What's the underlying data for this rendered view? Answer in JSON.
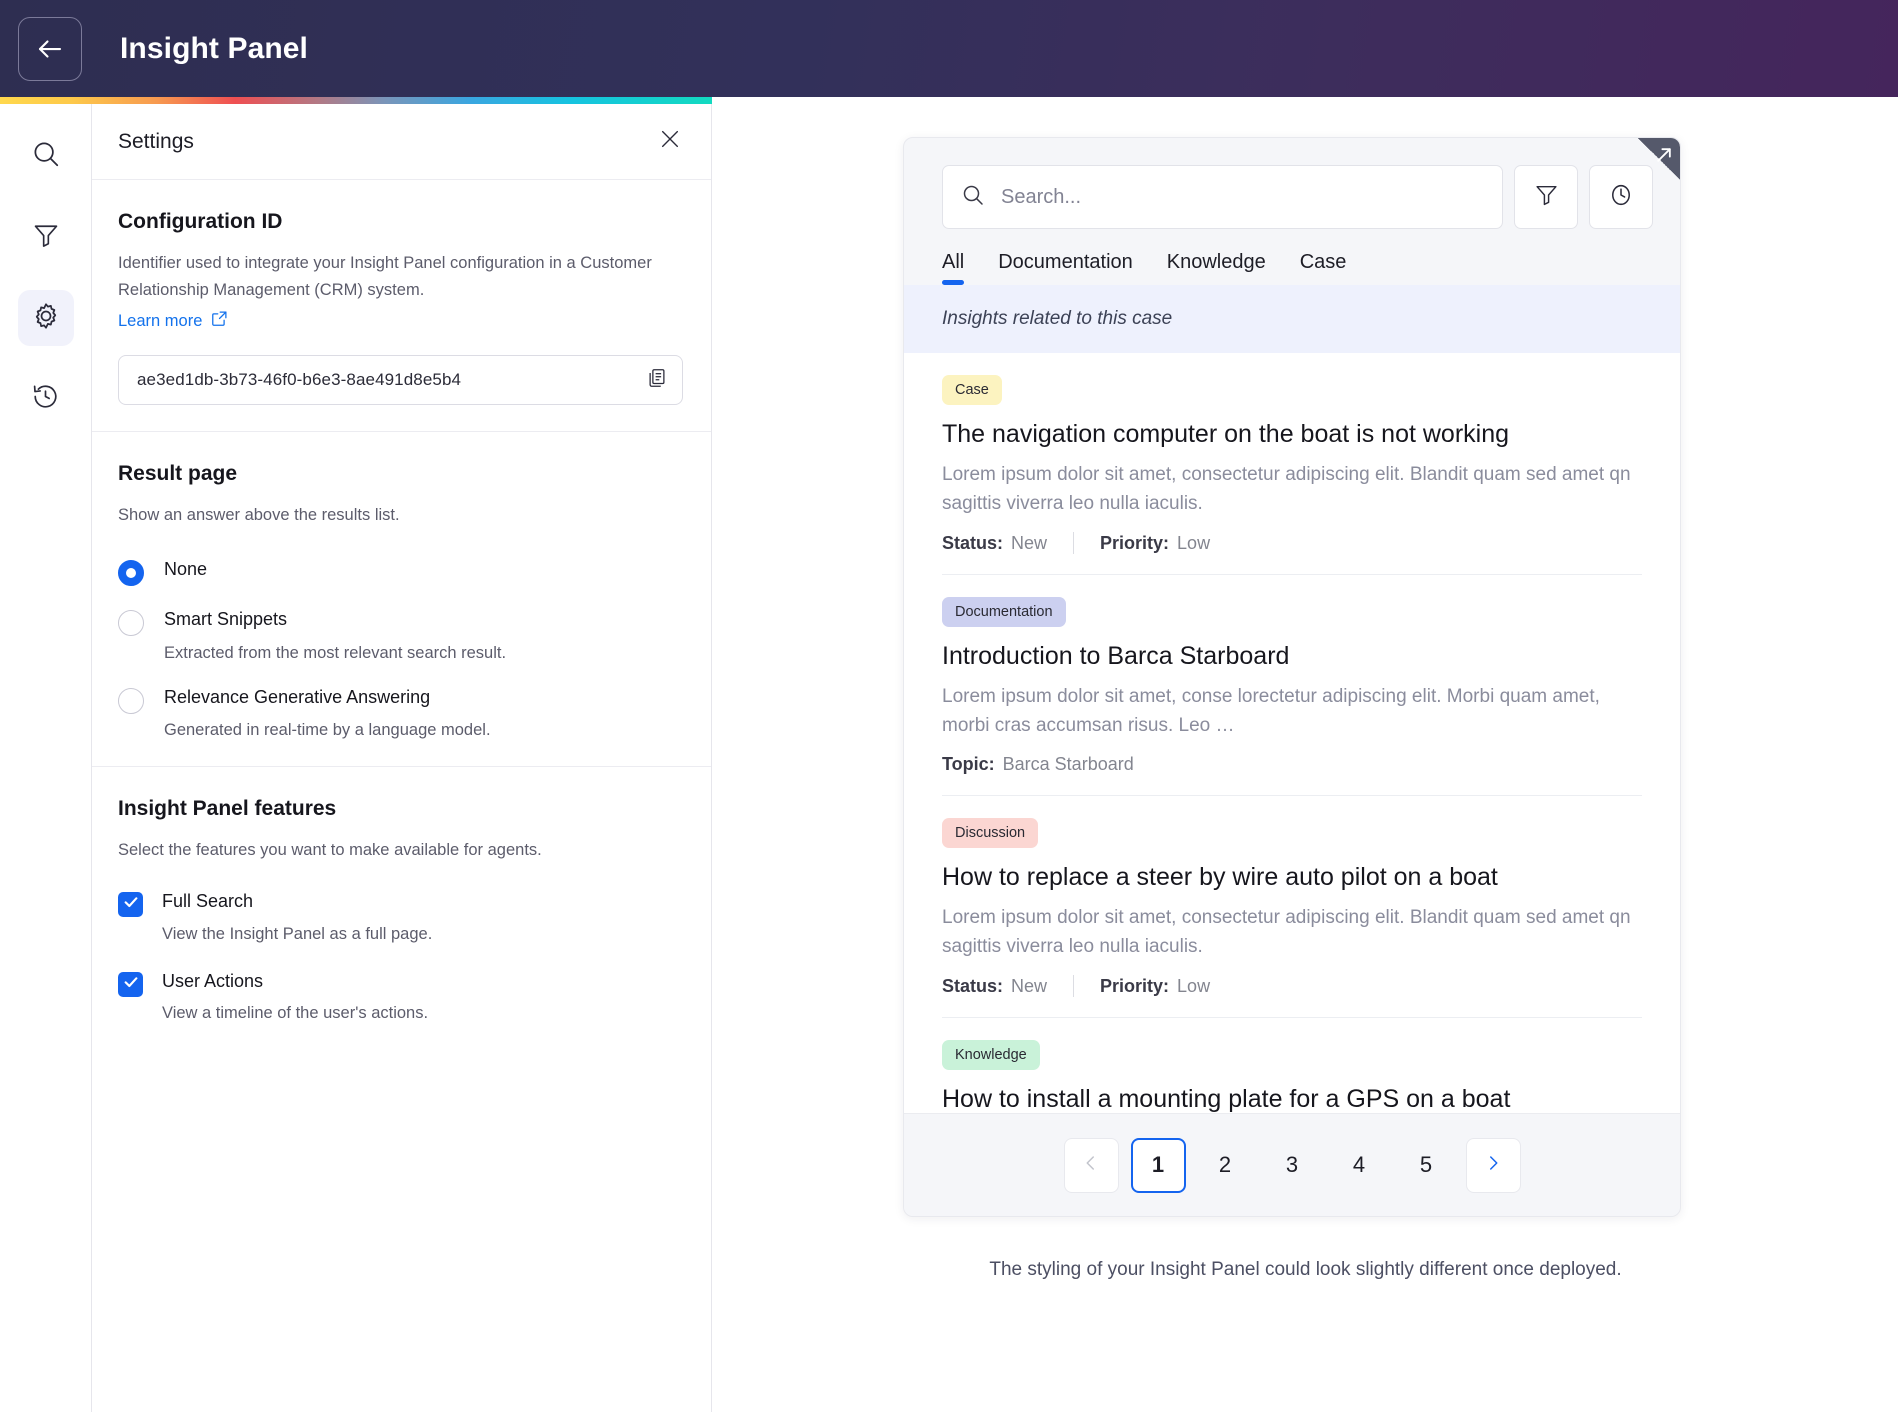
{
  "header": {
    "title": "Insight Panel",
    "back_icon": "arrow-left-icon"
  },
  "rail": {
    "items": [
      {
        "icon": "search-icon",
        "name": "rail-item-search",
        "active": false
      },
      {
        "icon": "filter-icon",
        "name": "rail-item-filter",
        "active": false
      },
      {
        "icon": "gear-icon",
        "name": "rail-item-settings",
        "active": true
      },
      {
        "icon": "history-icon",
        "name": "rail-item-history",
        "active": false
      }
    ]
  },
  "settings": {
    "panel_title": "Settings",
    "close_icon": "close-icon",
    "configuration": {
      "heading": "Configuration ID",
      "description": "Identifier used to integrate your Insight Panel configuration in a Customer Relationship Management (CRM) system.",
      "learn_more": "Learn more",
      "external_link_icon": "external-link-icon",
      "value": "ae3ed1db-3b73-46f0-b6e3-8ae491d8e5b4",
      "copy_icon": "copy-icon"
    },
    "result_page": {
      "heading": "Result page",
      "description": "Show an answer above the results list.",
      "options": [
        {
          "label": "None",
          "sub": "",
          "selected": true
        },
        {
          "label": "Smart Snippets",
          "sub": "Extracted from the most relevant search result.",
          "selected": false
        },
        {
          "label": "Relevance Generative Answering",
          "sub": "Generated in real-time by a language model.",
          "selected": false
        }
      ]
    },
    "features": {
      "heading": "Insight Panel features",
      "description": "Select the features you want to make available for agents.",
      "items": [
        {
          "label": "Full Search",
          "sub": "View the Insight Panel as a full page.",
          "checked": true
        },
        {
          "label": "User Actions",
          "sub": "View a timeline of the user's actions.",
          "checked": true
        }
      ]
    }
  },
  "preview": {
    "resize_icon": "resize-arrow-icon",
    "search": {
      "placeholder": "Search...",
      "search_icon": "search-icon",
      "filter_icon": "filter-icon",
      "history_icon": "clock-icon"
    },
    "tabs": [
      {
        "label": "All",
        "active": true
      },
      {
        "label": "Documentation",
        "active": false
      },
      {
        "label": "Knowledge",
        "active": false
      },
      {
        "label": "Case",
        "active": false
      }
    ],
    "banner": "Insights related to this case",
    "results": [
      {
        "badge": "Case",
        "badge_color": "#fcf3c0",
        "title": "The navigation computer on the boat is not working",
        "snippet": "Lorem ipsum dolor sit amet, consectetur adipiscing elit. Blandit quam sed amet qn sagittis viverra leo nulla iaculis.",
        "meta": [
          {
            "key": "Status:",
            "value": "New"
          },
          {
            "key": "Priority:",
            "value": "Low"
          }
        ]
      },
      {
        "badge": "Documentation",
        "badge_color": "#ccd0f0",
        "title": "Introduction to Barca Starboard",
        "snippet": "Lorem ipsum dolor sit amet, conse  lorectetur adipiscing elit. Morbi quam amet, morbi cras accumsan risus. Leo …",
        "meta": [
          {
            "key": "Topic:",
            "value": "Barca Starboard"
          }
        ]
      },
      {
        "badge": "Discussion",
        "badge_color": "#fbd6d2",
        "title": "How to replace a steer by wire auto pilot on a boat",
        "snippet": "Lorem ipsum dolor sit amet, consectetur adipiscing elit. Blandit quam sed amet qn sagittis viverra leo nulla iaculis.",
        "meta": [
          {
            "key": "Status:",
            "value": "New"
          },
          {
            "key": "Priority:",
            "value": "Low"
          }
        ]
      },
      {
        "badge": "Knowledge",
        "badge_color": "#c9f2d9",
        "title": "How to install a mounting plate for a GPS on a boat",
        "snippet": "",
        "meta": []
      }
    ],
    "pagination": {
      "prev_icon": "chevron-left-icon",
      "next_icon": "chevron-right-icon",
      "pages": [
        "1",
        "2",
        "3",
        "4",
        "5"
      ],
      "current": "1"
    },
    "footnote": "The styling of your Insight Panel could look slightly different once deployed."
  },
  "colors": {
    "accent": "#1464ef",
    "topbar_start": "#2e2e51",
    "topbar_end": "#45255c",
    "banner_bg": "#eef1fd"
  }
}
